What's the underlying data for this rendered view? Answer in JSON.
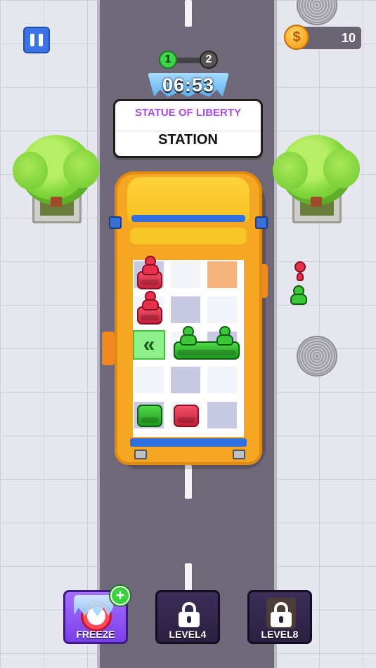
{
  "hud": {
    "coins": "10",
    "coin_symbol": "$",
    "level_progress": {
      "current": "1",
      "next": "2"
    },
    "timer": "06:53"
  },
  "station": {
    "destination": "STATUE OF LIBERTY",
    "label": "STATION"
  },
  "board": {
    "arrow_glyph": "«"
  },
  "boosters": [
    {
      "label": "FREEZE",
      "locked": false,
      "plus": "+"
    },
    {
      "label": "LEVEL4",
      "locked": true
    },
    {
      "label": "LEVEL8",
      "locked": true
    }
  ],
  "colors": {
    "road": "#6e6879",
    "bus": "#f5a623",
    "seat_red": "#e8304c",
    "seat_green": "#3cc63a",
    "freeze_booster": "#8a4cf0",
    "pause_button": "#3a73e6"
  }
}
